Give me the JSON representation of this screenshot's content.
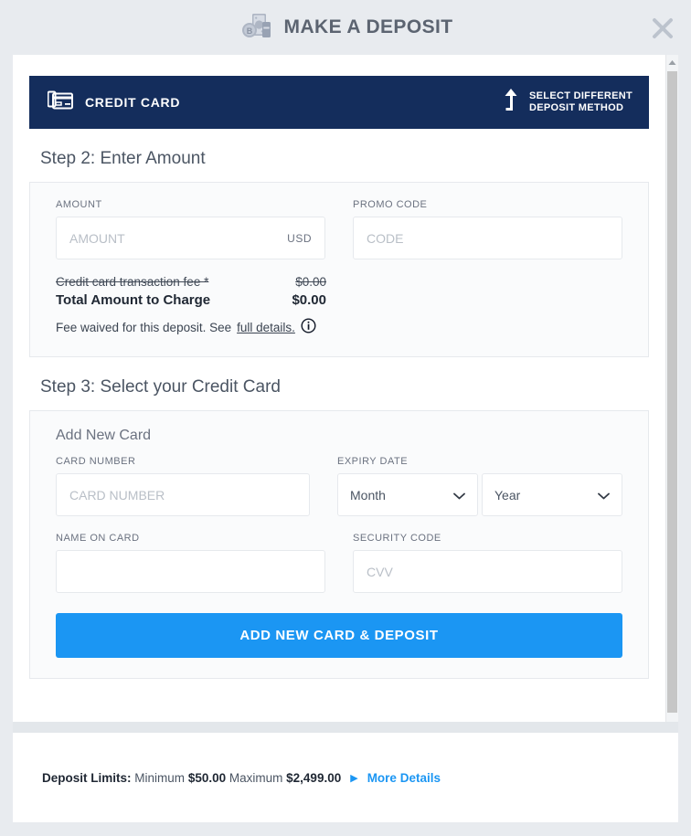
{
  "titlebar": {
    "title": "MAKE A DEPOSIT",
    "money_icon": "money-bitcoin-icon",
    "close_icon": "close-icon"
  },
  "method_bar": {
    "card_icon": "credit-card-icon",
    "label": "CREDIT CARD",
    "switch_icon": "up-arrow-icon",
    "switch_line1": "SELECT DIFFERENT",
    "switch_line2": "DEPOSIT METHOD"
  },
  "step2": {
    "heading": "Step 2: Enter Amount",
    "amount_label": "AMOUNT",
    "amount_placeholder": "AMOUNT",
    "amount_value": "",
    "currency": "USD",
    "promo_label": "PROMO CODE",
    "promo_placeholder": "CODE",
    "promo_value": "",
    "fee_label": "Credit card transaction fee *",
    "fee_value": "$0.00",
    "total_label": "Total Amount to Charge",
    "total_value": "$0.00",
    "waived_text": "Fee waived for this deposit. See",
    "waived_link": "full details.",
    "info_icon": "info-circle-icon"
  },
  "step3": {
    "heading": "Step 3: Select your Credit Card",
    "add_new_card": "Add New Card",
    "card_number_label": "CARD NUMBER",
    "card_number_placeholder": "CARD NUMBER",
    "card_number_value": "",
    "expiry_label": "EXPIRY DATE",
    "month_selected": "Month",
    "year_selected": "Year",
    "chevron_icon": "chevron-down-icon",
    "name_label": "NAME ON CARD",
    "name_placeholder": "",
    "name_value": "",
    "security_label": "SECURITY CODE",
    "security_placeholder": "CVV",
    "security_value": "",
    "submit_label": "ADD NEW CARD & DEPOSIT"
  },
  "footer": {
    "limits_label": "Deposit Limits:",
    "minimum_word": "Minimum",
    "minimum_value": "$50.00",
    "maximum_word": "Maximum",
    "maximum_value": "$2,499.00",
    "arrow_icon": "triangle-right-icon",
    "more_details": "More Details"
  },
  "scrollbar": {
    "up_arrow_icon": "scroll-up-arrow-icon"
  },
  "colors": {
    "navy": "#142d5c",
    "accent_blue": "#1b96f3",
    "page_bg": "#e8ebef"
  }
}
